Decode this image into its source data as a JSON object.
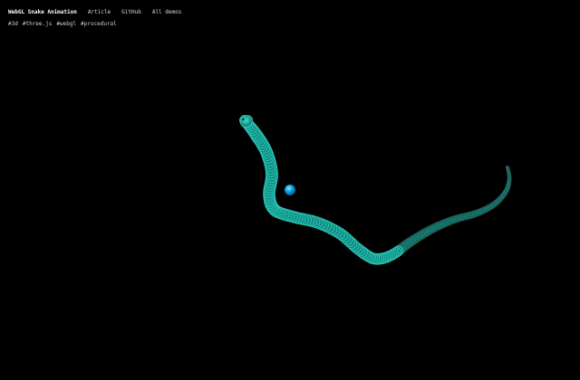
{
  "header": {
    "title": "WebGL Snake Animation",
    "links": [
      "Article",
      "GitHub",
      "All demos"
    ],
    "tags": [
      "#3d",
      "#three.js",
      "#webgl",
      "#procedural"
    ]
  },
  "scene": {
    "background_color": "#000000",
    "snake_base_color": "#0f8c82",
    "snake_highlight_color": "#2fd1c0",
    "snake_pattern_color": "#c0442a",
    "food_color": "#13a8ec"
  }
}
